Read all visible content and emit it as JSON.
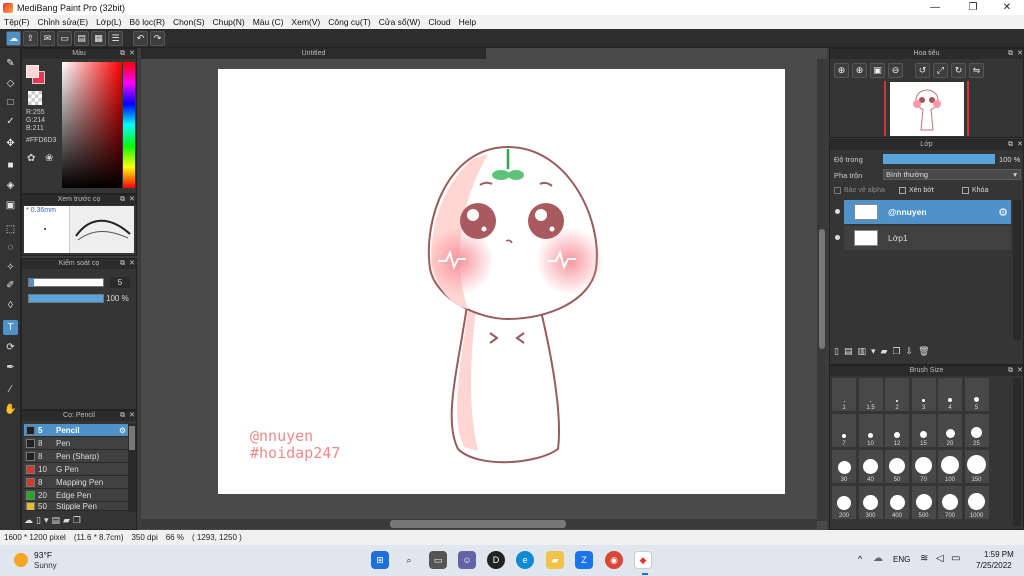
{
  "window": {
    "title": "MediBang Paint Pro (32bit)",
    "minimize": "—",
    "maximize": "❐",
    "close": "✕"
  },
  "menu": [
    "Tệp(F)",
    "Chỉnh sửa(E)",
    "Lớp(L)",
    "Bộ lọc(R)",
    "Chọn(S)",
    "Chụp(N)",
    "Màu (C)",
    "Xem(V)",
    "Công cụ(T)",
    "Cửa sổ(W)",
    "Cloud",
    "Help"
  ],
  "color_panel": {
    "title": "Màu",
    "r": "R:255",
    "g": "G:214",
    "b": "B:211",
    "hex": "#FFD6D3",
    "fg": "#FFD6D3",
    "bg": "#e8354a"
  },
  "brush_preview": {
    "title": "Xem trước cọ",
    "size": "* 0.36mm"
  },
  "brush_control": {
    "title": "Kiểm soát cọ",
    "size_value": "5",
    "opacity_value": "100 %"
  },
  "brush_list": {
    "title": "Cọ: Pencil",
    "items": [
      {
        "size": "5",
        "name": "Pencil",
        "color": "#222222"
      },
      {
        "size": "8",
        "name": "Pen",
        "color": "#222222"
      },
      {
        "size": "8",
        "name": "Pen (Sharp)",
        "color": "#222222"
      },
      {
        "size": "10",
        "name": "G Pen",
        "color": "#e03030"
      },
      {
        "size": "8",
        "name": "Mapping Pen",
        "color": "#e03030"
      },
      {
        "size": "20",
        "name": "Edge Pen",
        "color": "#22aa22"
      },
      {
        "size": "50",
        "name": "Stipple Pen",
        "color": "#e0c020"
      }
    ]
  },
  "document": {
    "tab": "Untitled",
    "signature_line1": "@nnuyen",
    "signature_line2": "#hoidap247"
  },
  "navigator": {
    "title": "Hoa tiêu"
  },
  "layers": {
    "title": "Lớp",
    "opacity_label": "Độ trong",
    "opacity_value": "100 %",
    "opacity_fraction": 1.0,
    "blend_label": "Pha trộn",
    "blend_value": "Bình thường",
    "protect_alpha": "Bảo vệ alpha",
    "clipping": "Xén bớt",
    "lock": "Khóa",
    "items": [
      {
        "name": "@nnuyen",
        "selected": true
      },
      {
        "name": "Lớp1",
        "selected": false
      }
    ]
  },
  "brush_size": {
    "title": "Brush Size",
    "sizes": [
      "1",
      "1.5",
      "2",
      "3",
      "4",
      "5",
      "7",
      "10",
      "12",
      "15",
      "20",
      "25",
      "30",
      "40",
      "50",
      "70",
      "100",
      "150",
      "200",
      "300",
      "400",
      "500",
      "700",
      "1000"
    ]
  },
  "status": {
    "dimensions": "1600 * 1200 pixel",
    "physical": "(11.6 * 8.7cm)",
    "dpi": "350 dpi",
    "zoom": "66 %",
    "coords": "( 1293, 1250 )"
  },
  "taskbar": {
    "temp": "93°F",
    "weather": "Sunny",
    "lang": "ENG",
    "time": "1:59 PM",
    "date": "7/25/2022"
  }
}
